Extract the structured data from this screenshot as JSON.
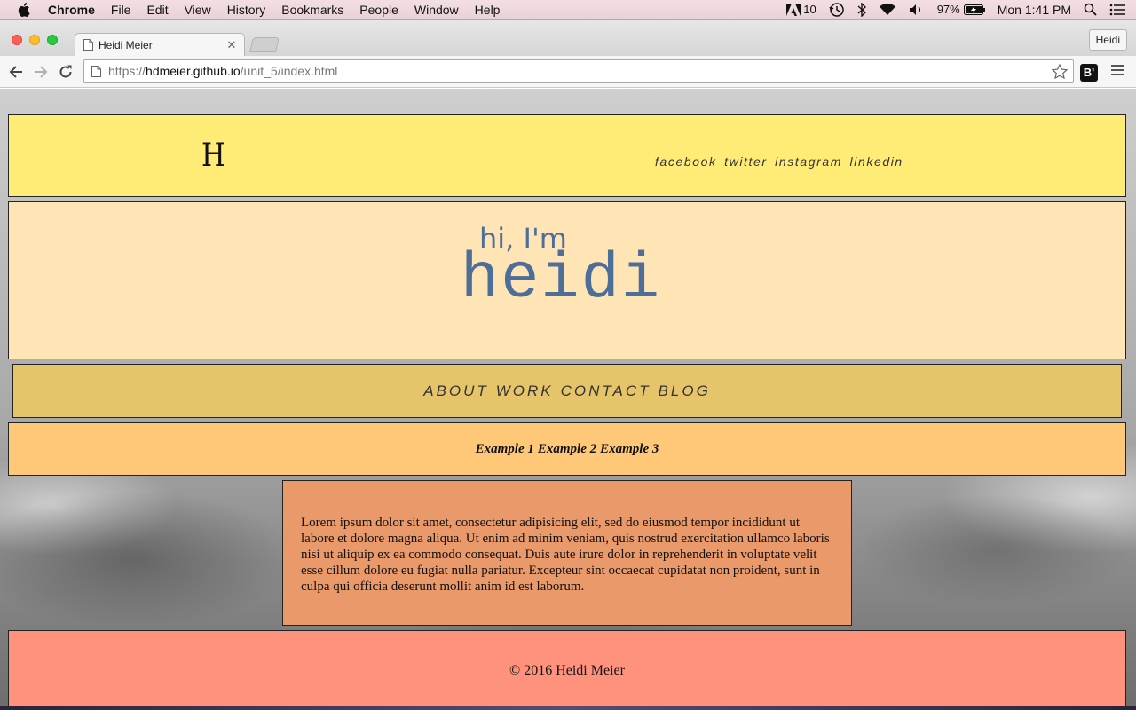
{
  "menubar": {
    "app_name": "Chrome",
    "items": [
      "File",
      "Edit",
      "View",
      "History",
      "Bookmarks",
      "People",
      "Window",
      "Help"
    ],
    "status": {
      "adobe_count": "10",
      "battery_percent": "97%",
      "clock": "Mon 1:41 PM"
    }
  },
  "browser": {
    "tab_title": "Heidi Meier",
    "profile_name": "Heidi",
    "url": {
      "scheme": "https://",
      "host": "hdmeier.github.io",
      "path": "/unit_5/index.html"
    },
    "extension_label": "B'"
  },
  "page": {
    "header": {
      "logo": "H",
      "social_links": [
        "facebook",
        "twitter",
        "instagram",
        "linkedin"
      ]
    },
    "hero": {
      "greeting": "hi, I'm",
      "name": "heidi"
    },
    "main_nav": [
      "ABOUT",
      "WORK",
      "CONTACT",
      "BLOG"
    ],
    "sub_nav": [
      "Example 1",
      "Example 2",
      "Example 3"
    ],
    "content_text": "Lorem ipsum dolor sit amet, consectetur adipisicing elit, sed do eiusmod tempor incididunt ut labore et dolore magna aliqua. Ut enim ad minim veniam, quis nostrud exercitation ullamco laboris nisi ut aliquip ex ea commodo consequat. Duis aute irure dolor in reprehenderit in voluptate velit esse cillum dolore eu fugiat nulla pariatur. Excepteur sint occaecat cupidatat non proident, sunt in culpa qui officia deserunt mollit anim id est laborum.",
    "footer": "© 2016 Heidi Meier"
  },
  "colors": {
    "header_bg": "#ffec77",
    "hero_bg": "#ffe4b6",
    "hero_text": "#4e6e9a",
    "nav_bg": "#e6c56a",
    "subnav_bg": "#ffc878",
    "content_bg": "#e9996a",
    "footer_bg": "#ff927c"
  },
  "icons": {
    "apple": "apple-icon",
    "adobe": "adobe-icon",
    "time_machine": "time-machine-icon",
    "bluetooth": "bluetooth-icon",
    "wifi": "wifi-icon",
    "volume": "volume-icon",
    "battery": "battery-icon",
    "spotlight": "search-icon",
    "notifications": "notification-center-icon",
    "back": "back-arrow-icon",
    "forward": "forward-arrow-icon",
    "reload": "reload-icon",
    "page": "page-icon",
    "bookmark": "star-icon",
    "menu": "hamburger-menu-icon"
  }
}
